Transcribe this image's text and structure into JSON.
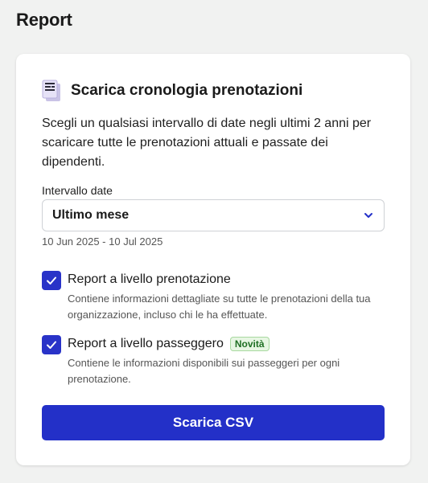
{
  "page": {
    "title": "Report"
  },
  "card": {
    "icon": "document-icon",
    "title": "Scarica cronologia prenotazioni",
    "description": "Scegli un qualsiasi intervallo di date negli ultimi 2 anni per scaricare tutte le prenotazioni attuali e passate dei dipendenti.",
    "date_field": {
      "label": "Intervallo date",
      "selected": "Ultimo mese",
      "range_text": "10 Jun 2025 - 10 Jul 2025"
    },
    "options": [
      {
        "title": "Report a livello prenotazione",
        "description": "Contiene informazioni dettagliate su tutte le prenotazioni della tua organizzazione, incluso chi le ha effettuate.",
        "checked": true
      },
      {
        "title": "Report a livello passeggero",
        "badge": "Novità",
        "description": "Contiene le informazioni disponibili sui passeggeri per ogni prenotazione.",
        "checked": true
      }
    ],
    "download_button": "Scarica CSV"
  },
  "colors": {
    "accent": "#2330c8",
    "badge_text": "#1f6f24",
    "badge_bg": "#e7f6e3",
    "background": "#f1f2f1"
  }
}
